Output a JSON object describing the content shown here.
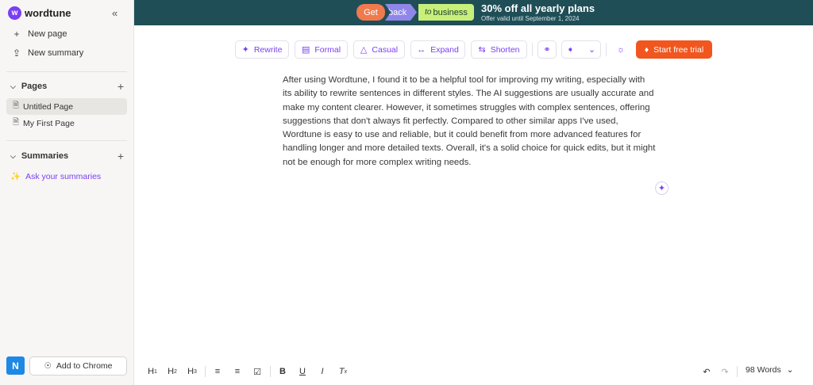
{
  "app": {
    "name": "wordtune",
    "logo_letter": "w",
    "accent": "#7a3ff2"
  },
  "sidebar": {
    "collapse_icon": "«",
    "actions": [
      {
        "label": "New page",
        "icon": "+"
      },
      {
        "label": "New summary",
        "icon": "⇪"
      }
    ],
    "pages_section": {
      "title": "Pages",
      "items": [
        "Untitled Page",
        "My First Page"
      ]
    },
    "summaries_section": {
      "title": "Summaries",
      "ask_label": "Ask your summaries"
    },
    "user_initial": "N",
    "add_to_chrome": "Add to Chrome"
  },
  "banner": {
    "get": "Get",
    "back": "back",
    "to": "to",
    "business": "business",
    "headline": "30% off all yearly plans",
    "subtext": "Offer valid until September 1, 2024"
  },
  "toolbar": {
    "rewrite": "Rewrite",
    "formal": "Formal",
    "casual": "Casual",
    "expand": "Expand",
    "shorten": "Shorten",
    "start_trial": "Start free trial"
  },
  "editor": {
    "text": "After using Wordtune, I found it to be a helpful tool for improving my writing, especially with its ability to rewrite sentences in different styles. The AI suggestions are usually accurate and make my content clearer. However, it sometimes struggles with complex sentences, offering suggestions that don't always fit perfectly. Compared to other similar apps I've used, Wordtune is easy to use and reliable, but it could benefit from more advanced features for handling longer and more detailed texts. Overall, it's a solid choice for quick edits, but it might not be enough for more complex writing needs."
  },
  "bottom_bar": {
    "h1": "H",
    "h1_sub": "1",
    "h2": "H",
    "h2_sub": "2",
    "h3": "H",
    "h3_sub": "3",
    "bold": "B",
    "underline": "U",
    "italic": "I",
    "clear": "T",
    "word_count": "98 Words"
  }
}
